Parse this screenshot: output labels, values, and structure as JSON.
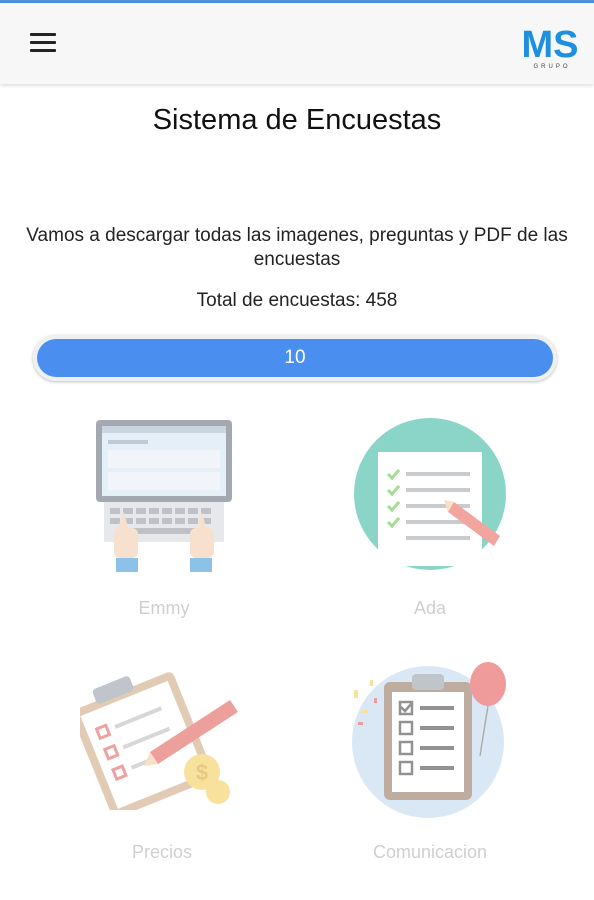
{
  "app": {
    "logo_text": "MS",
    "logo_subtext": "GRUPO"
  },
  "main": {
    "title": "Sistema de Encuestas",
    "description": "Vamos a descargar todas las imagenes, preguntas y PDF de las encuestas",
    "total_label": "Total de encuestas: 458",
    "progress": {
      "value": 10,
      "label": "10"
    }
  },
  "surveys": [
    {
      "label": "Emmy",
      "icon": "laptop-icon"
    },
    {
      "label": "Ada",
      "icon": "checklist-document-icon"
    },
    {
      "label": "Precios",
      "icon": "clipboard-pencil-icon"
    },
    {
      "label": "Comunicacion",
      "icon": "clipboard-balloon-icon"
    }
  ],
  "colors": {
    "accent": "#4a8ff0",
    "top_bar": "#4a8fd8",
    "label_muted": "#a9a9a9"
  }
}
